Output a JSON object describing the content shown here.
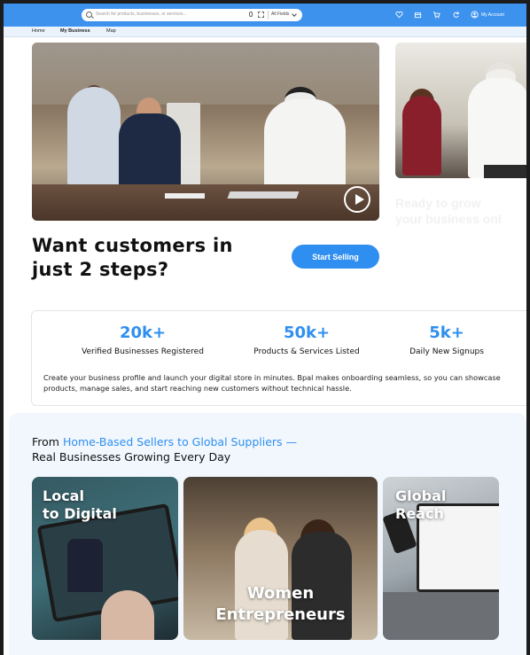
{
  "topbar": {
    "search_placeholder": "Search for products, businesses, or services...",
    "filter_label": "All Fields",
    "account_label": "My Account",
    "icons": [
      "heart-icon",
      "box-icon",
      "cart-icon",
      "refresh-icon",
      "user-icon"
    ],
    "accent": "#3d92ee"
  },
  "nav": {
    "items": [
      "Home",
      "My Business",
      "Map"
    ],
    "active": "My Business"
  },
  "hero": {
    "side_text_line1": "Ready to grow",
    "side_text_line2": "your business onl"
  },
  "cta": {
    "headline": "Want customers in just 2 steps?",
    "button": "Start Selling"
  },
  "stats": {
    "items": [
      {
        "value": "20k+",
        "label": "Verified Businesses Registered"
      },
      {
        "value": "50k+",
        "label": "Products & Services Listed"
      },
      {
        "value": "5k+",
        "label": "Daily New Signups"
      }
    ],
    "description": "Create your business profile and launch your digital store in minutes. Bpal makes onboarding seamless, so you can showcase products, manage sales, and start reaching new customers without technical hassle."
  },
  "growth": {
    "title_prefix": "From ",
    "title_highlight": "Home-Based Sellers to Global Suppliers —",
    "subtitle": "Real Businesses Growing Every Day",
    "cards": [
      {
        "line1": "Local",
        "line2": "to Digital"
      },
      {
        "line1": "Women",
        "line2": "Entrepreneurs"
      },
      {
        "line1": "Global",
        "line2": "Reach"
      }
    ]
  }
}
